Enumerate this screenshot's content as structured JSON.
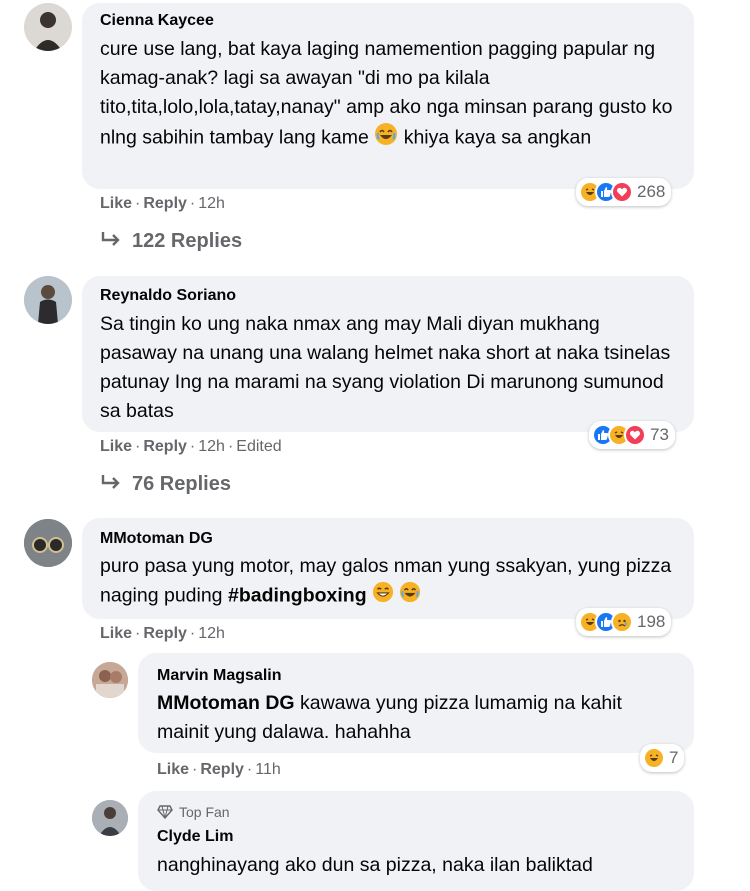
{
  "comments": [
    {
      "author": "Cienna Kaycee",
      "text": "cure use lang, bat kaya laging namemention pagging papular ng kamag-anak? lagi sa awayan \"di mo pa kilala tito,tita,lolo,lola,tatay,nanay\" amp ako nga minsan parang gusto ko nlng sabihin tambay lang kame",
      "text_tail": "khiya kaya sa angkan",
      "like": "Like",
      "reply": "Reply",
      "time": "12h",
      "reaction_count": "268",
      "replies_label": "122 Replies"
    },
    {
      "author": "Reynaldo Soriano",
      "text": "Sa tingin ko ung naka nmax ang may Mali diyan mukhang pasaway na unang una walang helmet naka short at naka tsinelas patunay Ing na marami na syang violation Di marunong sumunod sa batas",
      "like": "Like",
      "reply": "Reply",
      "time": "12h",
      "edited": "Edited",
      "reaction_count": "73",
      "replies_label": "76 Replies"
    },
    {
      "author": "MMotoman DG",
      "text": "puro pasa yung motor, may galos nman yung ssakyan, yung pizza naging puding",
      "hashtag": "#badingboxing",
      "like": "Like",
      "reply": "Reply",
      "time": "12h",
      "reaction_count": "198"
    }
  ],
  "replies": [
    {
      "author": "Marvin Magsalin",
      "mention": "MMotoman DG",
      "text": "kawawa yung pizza lumamig na kahit mainit yung dalawa. hahahha",
      "like": "Like",
      "reply": "Reply",
      "time": "11h",
      "reaction_count": "7"
    },
    {
      "badge": "Top Fan",
      "author": "Clyde Lim",
      "text": "nanghinayang ako dun sa pizza, naka ilan baliktad"
    }
  ],
  "colors": {
    "bubble": "#f0f2f5",
    "meta": "#65676b",
    "like_blue": "#1877f2",
    "love_red": "#f33e58",
    "haha_yellow": "#f7b125"
  },
  "icons": [
    "reply-arrow-icon",
    "haha-icon",
    "like-icon",
    "love-icon",
    "sad-icon",
    "top-fan-icon"
  ]
}
